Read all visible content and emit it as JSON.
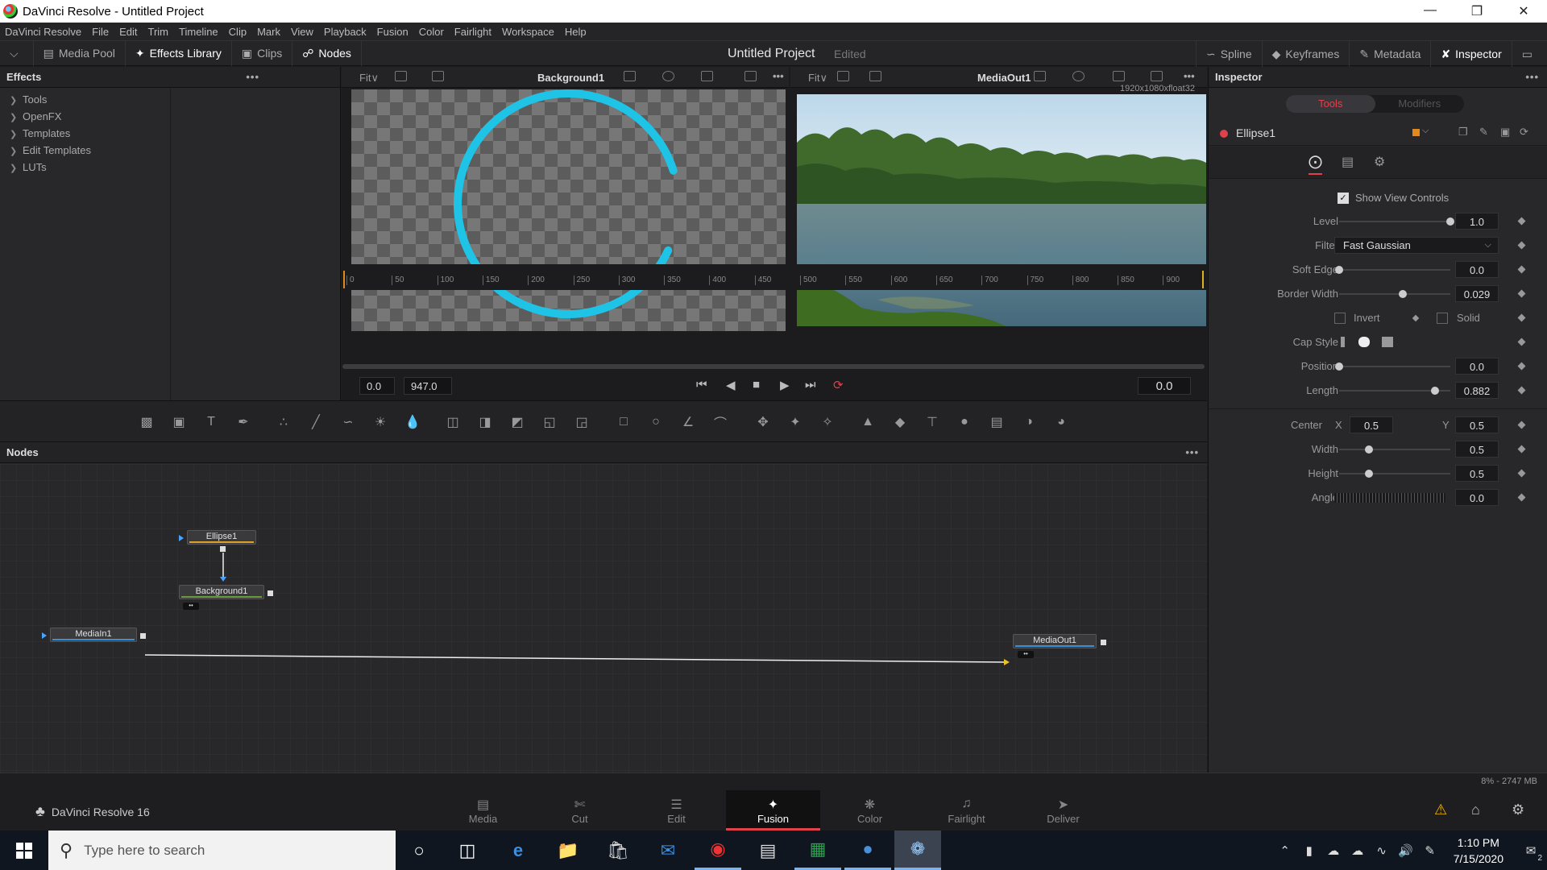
{
  "window": {
    "title": "DaVinci Resolve - Untitled Project"
  },
  "menu": [
    "DaVinci Resolve",
    "File",
    "Edit",
    "Trim",
    "Timeline",
    "Clip",
    "Mark",
    "View",
    "Playback",
    "Fusion",
    "Color",
    "Fairlight",
    "Workspace",
    "Help"
  ],
  "toolbar": {
    "media_pool": "Media Pool",
    "effects_library": "Effects Library",
    "clips": "Clips",
    "nodes": "Nodes",
    "project_title": "Untitled Project",
    "project_status": "Edited",
    "spline": "Spline",
    "keyframes": "Keyframes",
    "metadata": "Metadata",
    "inspector": "Inspector"
  },
  "effects": {
    "header": "Effects",
    "items": [
      "Tools",
      "OpenFX",
      "Templates",
      "Edit Templates",
      "LUTs"
    ]
  },
  "viewer_left": {
    "fit": "Fit∨",
    "name": "Background1",
    "arc_color": "#1fc3e6",
    "arc_fraction": 0.882,
    "border_width": 0.029
  },
  "viewer_right": {
    "fit": "Fit∨",
    "name": "MediaOut1",
    "resolution": "1920x1080xfloat32"
  },
  "ruler": [
    "0",
    "50",
    "100",
    "150",
    "200",
    "250",
    "300",
    "350",
    "400",
    "450",
    "500",
    "550",
    "600",
    "650",
    "700",
    "750",
    "800",
    "850",
    "900"
  ],
  "transport": {
    "start": "0.0",
    "end": "947.0",
    "current": "0.0"
  },
  "nodes_panel": {
    "header": "Nodes",
    "nodes": [
      "Ellipse1",
      "Background1",
      "MediaIn1",
      "MediaOut1"
    ]
  },
  "inspector": {
    "header": "Inspector",
    "tab_tools": "Tools",
    "tab_modifiers": "Modifiers",
    "tool_name": "Ellipse1",
    "show_view_controls": "Show View Controls",
    "level_label": "Level",
    "level": "1.0",
    "filter_label": "Filter",
    "filter": "Fast Gaussian",
    "soft_edge_label": "Soft Edge",
    "soft_edge": "0.0",
    "border_width_label": "Border Width",
    "border_width": "0.029",
    "invert": "Invert",
    "solid": "Solid",
    "cap_style_label": "Cap Style",
    "position_label": "Position",
    "position": "0.0",
    "length_label": "Length",
    "length": "0.882",
    "center_label": "Center",
    "x_label": "X",
    "center_x": "0.5",
    "y_label": "Y",
    "center_y": "0.5",
    "width_label": "Width",
    "width": "0.5",
    "height_label": "Height",
    "height": "0.5",
    "angle_label": "Angle",
    "angle": "0.0"
  },
  "status": {
    "memory": "8% - 2747 MB"
  },
  "pages": {
    "brand": "DaVinci Resolve 16",
    "tabs": [
      "Media",
      "Cut",
      "Edit",
      "Fusion",
      "Color",
      "Fairlight",
      "Deliver"
    ],
    "active": "Fusion",
    "accent": "#e0414b"
  },
  "taskbar": {
    "search_placeholder": "Type here to search",
    "time": "1:10 PM",
    "date": "7/15/2020",
    "notifications": "2"
  }
}
